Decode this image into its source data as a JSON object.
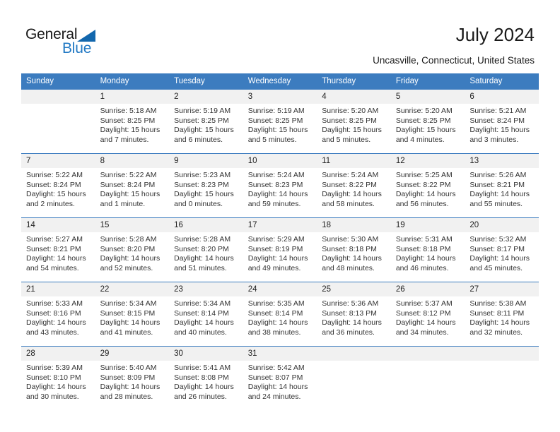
{
  "brand": {
    "name_top": "General",
    "name_bottom": "Blue",
    "accent_color": "#2279c4",
    "triangle_color": "#1267ad"
  },
  "header": {
    "title": "July 2024",
    "subtitle": "Uncasville, Connecticut, United States",
    "header_bg": "#3c7cbf",
    "daynum_bg": "#f1f1f1"
  },
  "calendar": {
    "weekday_headers": [
      "Sunday",
      "Monday",
      "Tuesday",
      "Wednesday",
      "Thursday",
      "Friday",
      "Saturday"
    ],
    "weeks": [
      [
        {
          "day": "",
          "lines": []
        },
        {
          "day": "1",
          "lines": [
            "Sunrise: 5:18 AM",
            "Sunset: 8:25 PM",
            "Daylight: 15 hours",
            "and 7 minutes."
          ]
        },
        {
          "day": "2",
          "lines": [
            "Sunrise: 5:19 AM",
            "Sunset: 8:25 PM",
            "Daylight: 15 hours",
            "and 6 minutes."
          ]
        },
        {
          "day": "3",
          "lines": [
            "Sunrise: 5:19 AM",
            "Sunset: 8:25 PM",
            "Daylight: 15 hours",
            "and 5 minutes."
          ]
        },
        {
          "day": "4",
          "lines": [
            "Sunrise: 5:20 AM",
            "Sunset: 8:25 PM",
            "Daylight: 15 hours",
            "and 5 minutes."
          ]
        },
        {
          "day": "5",
          "lines": [
            "Sunrise: 5:20 AM",
            "Sunset: 8:25 PM",
            "Daylight: 15 hours",
            "and 4 minutes."
          ]
        },
        {
          "day": "6",
          "lines": [
            "Sunrise: 5:21 AM",
            "Sunset: 8:24 PM",
            "Daylight: 15 hours",
            "and 3 minutes."
          ]
        }
      ],
      [
        {
          "day": "7",
          "lines": [
            "Sunrise: 5:22 AM",
            "Sunset: 8:24 PM",
            "Daylight: 15 hours",
            "and 2 minutes."
          ]
        },
        {
          "day": "8",
          "lines": [
            "Sunrise: 5:22 AM",
            "Sunset: 8:24 PM",
            "Daylight: 15 hours",
            "and 1 minute."
          ]
        },
        {
          "day": "9",
          "lines": [
            "Sunrise: 5:23 AM",
            "Sunset: 8:23 PM",
            "Daylight: 15 hours",
            "and 0 minutes."
          ]
        },
        {
          "day": "10",
          "lines": [
            "Sunrise: 5:24 AM",
            "Sunset: 8:23 PM",
            "Daylight: 14 hours",
            "and 59 minutes."
          ]
        },
        {
          "day": "11",
          "lines": [
            "Sunrise: 5:24 AM",
            "Sunset: 8:22 PM",
            "Daylight: 14 hours",
            "and 58 minutes."
          ]
        },
        {
          "day": "12",
          "lines": [
            "Sunrise: 5:25 AM",
            "Sunset: 8:22 PM",
            "Daylight: 14 hours",
            "and 56 minutes."
          ]
        },
        {
          "day": "13",
          "lines": [
            "Sunrise: 5:26 AM",
            "Sunset: 8:21 PM",
            "Daylight: 14 hours",
            "and 55 minutes."
          ]
        }
      ],
      [
        {
          "day": "14",
          "lines": [
            "Sunrise: 5:27 AM",
            "Sunset: 8:21 PM",
            "Daylight: 14 hours",
            "and 54 minutes."
          ]
        },
        {
          "day": "15",
          "lines": [
            "Sunrise: 5:28 AM",
            "Sunset: 8:20 PM",
            "Daylight: 14 hours",
            "and 52 minutes."
          ]
        },
        {
          "day": "16",
          "lines": [
            "Sunrise: 5:28 AM",
            "Sunset: 8:20 PM",
            "Daylight: 14 hours",
            "and 51 minutes."
          ]
        },
        {
          "day": "17",
          "lines": [
            "Sunrise: 5:29 AM",
            "Sunset: 8:19 PM",
            "Daylight: 14 hours",
            "and 49 minutes."
          ]
        },
        {
          "day": "18",
          "lines": [
            "Sunrise: 5:30 AM",
            "Sunset: 8:18 PM",
            "Daylight: 14 hours",
            "and 48 minutes."
          ]
        },
        {
          "day": "19",
          "lines": [
            "Sunrise: 5:31 AM",
            "Sunset: 8:18 PM",
            "Daylight: 14 hours",
            "and 46 minutes."
          ]
        },
        {
          "day": "20",
          "lines": [
            "Sunrise: 5:32 AM",
            "Sunset: 8:17 PM",
            "Daylight: 14 hours",
            "and 45 minutes."
          ]
        }
      ],
      [
        {
          "day": "21",
          "lines": [
            "Sunrise: 5:33 AM",
            "Sunset: 8:16 PM",
            "Daylight: 14 hours",
            "and 43 minutes."
          ]
        },
        {
          "day": "22",
          "lines": [
            "Sunrise: 5:34 AM",
            "Sunset: 8:15 PM",
            "Daylight: 14 hours",
            "and 41 minutes."
          ]
        },
        {
          "day": "23",
          "lines": [
            "Sunrise: 5:34 AM",
            "Sunset: 8:14 PM",
            "Daylight: 14 hours",
            "and 40 minutes."
          ]
        },
        {
          "day": "24",
          "lines": [
            "Sunrise: 5:35 AM",
            "Sunset: 8:14 PM",
            "Daylight: 14 hours",
            "and 38 minutes."
          ]
        },
        {
          "day": "25",
          "lines": [
            "Sunrise: 5:36 AM",
            "Sunset: 8:13 PM",
            "Daylight: 14 hours",
            "and 36 minutes."
          ]
        },
        {
          "day": "26",
          "lines": [
            "Sunrise: 5:37 AM",
            "Sunset: 8:12 PM",
            "Daylight: 14 hours",
            "and 34 minutes."
          ]
        },
        {
          "day": "27",
          "lines": [
            "Sunrise: 5:38 AM",
            "Sunset: 8:11 PM",
            "Daylight: 14 hours",
            "and 32 minutes."
          ]
        }
      ],
      [
        {
          "day": "28",
          "lines": [
            "Sunrise: 5:39 AM",
            "Sunset: 8:10 PM",
            "Daylight: 14 hours",
            "and 30 minutes."
          ]
        },
        {
          "day": "29",
          "lines": [
            "Sunrise: 5:40 AM",
            "Sunset: 8:09 PM",
            "Daylight: 14 hours",
            "and 28 minutes."
          ]
        },
        {
          "day": "30",
          "lines": [
            "Sunrise: 5:41 AM",
            "Sunset: 8:08 PM",
            "Daylight: 14 hours",
            "and 26 minutes."
          ]
        },
        {
          "day": "31",
          "lines": [
            "Sunrise: 5:42 AM",
            "Sunset: 8:07 PM",
            "Daylight: 14 hours",
            "and 24 minutes."
          ]
        },
        {
          "day": "",
          "lines": []
        },
        {
          "day": "",
          "lines": []
        },
        {
          "day": "",
          "lines": []
        }
      ]
    ]
  }
}
